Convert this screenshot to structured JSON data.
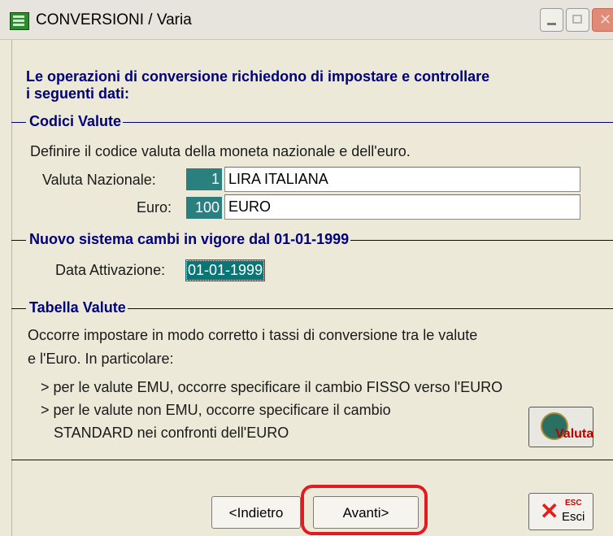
{
  "window": {
    "title": "CONVERSIONI / Varia",
    "icons": [
      "app-icon",
      "minimize-icon",
      "maximize-icon",
      "close-icon"
    ]
  },
  "intro": {
    "line1": "Le operazioni di conversione richiedono di impostare e controllare",
    "line2": "i seguenti dati:"
  },
  "codici_valute": {
    "heading": "Codici Valute",
    "description": "Definire il codice valuta della moneta nazionale e dell'euro.",
    "valuta_nazionale": {
      "label": "Valuta Nazionale:",
      "code": "1",
      "name": "LIRA ITALIANA"
    },
    "euro": {
      "label": "Euro:",
      "code": "100",
      "name": "EURO"
    }
  },
  "nuovo_sistema": {
    "heading": "Nuovo sistema cambi in vigore dal 01-01-1999",
    "data_attivazione": {
      "label": "Data Attivazione:",
      "value": "01-01-1999"
    }
  },
  "tabella_valute": {
    "heading": "Tabella Valute",
    "text1": "Occorre impostare in modo corretto i tassi di conversione tra le valute",
    "text2": "e l'Euro. In particolare:",
    "bullet1": "> per le valute EMU, occorre specificare il cambio FISSO verso l'EURO",
    "bullet2a": "> per le valute non EMU, occorre specificare il cambio",
    "bullet2b": "STANDARD nei confronti dell'EURO",
    "valuta_button": "Valuta"
  },
  "buttons": {
    "indietro": "<Indietro",
    "avanti": "Avanti>",
    "esci_key": "ESC",
    "esci": "Esci"
  },
  "colors": {
    "accent": "#00007a",
    "field_highlight": "#2a7f7f",
    "annotation": "#e11b22"
  }
}
